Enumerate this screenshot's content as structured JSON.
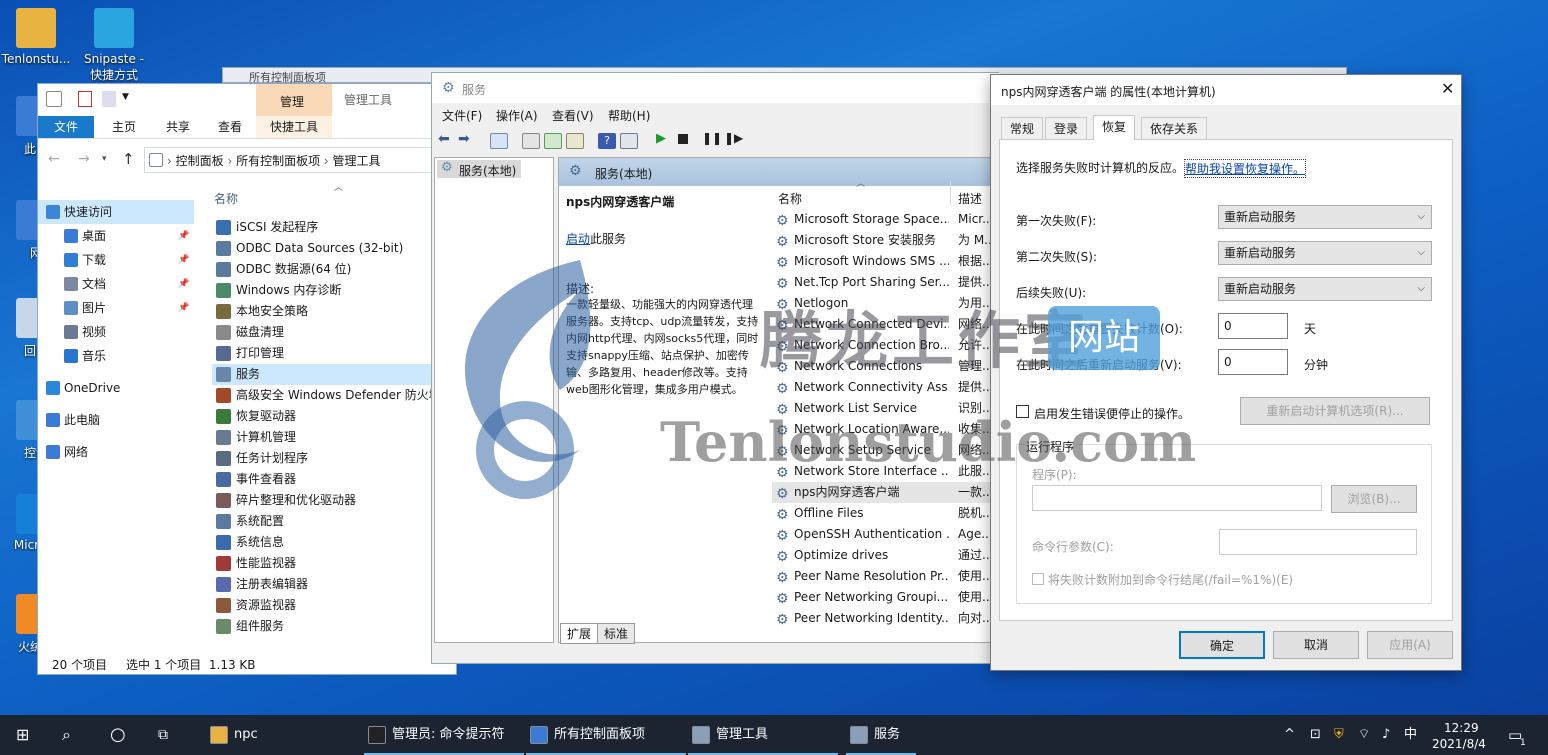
{
  "desktop": {
    "icons": [
      {
        "label": "Tenlonstu...",
        "color": "#e8b341"
      },
      {
        "label": "Snipaste - 快捷方式",
        "color": "#2aa5e0"
      },
      {
        "label": "此电",
        "color": "#3a7bd5"
      },
      {
        "label": "网",
        "color": "#3a7bd5"
      },
      {
        "label": "回收",
        "color": "#c7d6e8"
      },
      {
        "label": "控制",
        "color": "#3e8fd8"
      },
      {
        "label": "Micr Ed",
        "color": "#1480d8"
      },
      {
        "label": "火绒安",
        "color": "#f08a24"
      }
    ]
  },
  "background_window": {
    "title": "所有控制面板项"
  },
  "explorer": {
    "ribbon_tabs": [
      "文件",
      "主页",
      "共享",
      "查看",
      "快捷工具"
    ],
    "manage_tab": "管理",
    "manage_title": "管理工具",
    "address": [
      "控制面板",
      "所有控制面板项",
      "管理工具"
    ],
    "column_name": "名称",
    "nav": [
      {
        "label": "快速访问",
        "color": "#3b86d9",
        "pin": false
      },
      {
        "label": "桌面",
        "color": "#3a7bd5",
        "pin": true
      },
      {
        "label": "下载",
        "color": "#2f7fd4",
        "pin": true
      },
      {
        "label": "文档",
        "color": "#7c8aa0",
        "pin": true
      },
      {
        "label": "图片",
        "color": "#5b8fc6",
        "pin": true
      },
      {
        "label": "视频",
        "color": "#6a7a90",
        "pin": false
      },
      {
        "label": "音乐",
        "color": "#2a76cf",
        "pin": false
      },
      {
        "label": "OneDrive",
        "color": "#2b88d8",
        "pin": false
      },
      {
        "label": "此电脑",
        "color": "#3a7bd5",
        "pin": false
      },
      {
        "label": "网络",
        "color": "#3a7bd5",
        "pin": false
      }
    ],
    "files": [
      "iSCSI 发起程序",
      "ODBC Data Sources (32-bit)",
      "ODBC 数据源(64 位)",
      "Windows 内存诊断",
      "本地安全策略",
      "磁盘清理",
      "打印管理",
      "服务",
      "高级安全 Windows Defender 防火墙",
      "恢复驱动器",
      "计算机管理",
      "任务计划程序",
      "事件查看器",
      "碎片整理和优化驱动器",
      "系统配置",
      "系统信息",
      "性能监视器",
      "注册表编辑器",
      "资源监视器",
      "组件服务"
    ],
    "status_count": "20 个项目",
    "status_selected": "选中 1 个项目  1.13 KB"
  },
  "services": {
    "title": "服务",
    "menu": [
      "文件(F)",
      "操作(A)",
      "查看(V)",
      "帮助(H)"
    ],
    "tree_item": "服务(本地)",
    "header": "服务(本地)",
    "selected_name": "nps内网穿透客户端",
    "start_link": "启动",
    "start_suffix": "此服务",
    "desc_label": "描述:",
    "desc": "一款轻量级、功能强大的内网穿透代理服务器。支持tcp、udp流量转发，支持内网http代理、内网socks5代理，同时支持snappy压缩、站点保护、加密传输、多路复用、header修改等。支持web图形化管理，集成多用户模式。",
    "col_name": "名称",
    "col_desc": "描述",
    "rows": [
      {
        "name": "Microsoft Storage Space...",
        "desc": "Micr..."
      },
      {
        "name": "Microsoft Store 安装服务",
        "desc": "为 M..."
      },
      {
        "name": "Microsoft Windows SMS ...",
        "desc": "根据..."
      },
      {
        "name": "Net.Tcp Port Sharing Ser...",
        "desc": "提供..."
      },
      {
        "name": "Netlogon",
        "desc": "为用..."
      },
      {
        "name": "Network Connected Devi...",
        "desc": "网络..."
      },
      {
        "name": "Network Connection Bro...",
        "desc": "允许..."
      },
      {
        "name": "Network Connections",
        "desc": "管理..."
      },
      {
        "name": "Network Connectivity Ass...",
        "desc": "提供..."
      },
      {
        "name": "Network List Service",
        "desc": "识别..."
      },
      {
        "name": "Network Location Aware...",
        "desc": "收集..."
      },
      {
        "name": "Network Setup Service",
        "desc": "网络..."
      },
      {
        "name": "Network Store Interface ...",
        "desc": "此服..."
      },
      {
        "name": "nps内网穿透客户端",
        "desc": "一款..."
      },
      {
        "name": "Offline Files",
        "desc": "脱机..."
      },
      {
        "name": "OpenSSH Authentication ...",
        "desc": "Age..."
      },
      {
        "name": "Optimize drives",
        "desc": "通过..."
      },
      {
        "name": "Peer Name Resolution Pr...",
        "desc": "使用..."
      },
      {
        "name": "Peer Networking Groupi...",
        "desc": "使用..."
      },
      {
        "name": "Peer Networking Identity...",
        "desc": "向对..."
      }
    ],
    "bottom_tabs": [
      "扩展",
      "标准"
    ]
  },
  "props": {
    "title": "nps内网穿透客户端 的属性(本地计算机)",
    "tabs": [
      "常规",
      "登录",
      "恢复",
      "依存关系"
    ],
    "intro": "选择服务失败时计算机的反应。",
    "help_link": "帮助我设置恢复操作。",
    "first_label": "第一次失败(F):",
    "first_value": "重新启动服务",
    "second_label": "第二次失败(S):",
    "second_value": "重新启动服务",
    "subsequent_label": "后续失败(U):",
    "subsequent_value": "重新启动服务",
    "reset_label": "在此时间之后重置失败计数(O):",
    "reset_value": "0",
    "reset_unit": "天",
    "restart_label": "在此时间之后重新启动服务(V):",
    "restart_value": "0",
    "restart_unit": "分钟",
    "enable_actions": "启用发生错误便停止的操作。",
    "restart_computer_btn": "重新启动计算机选项(R)...",
    "run_program_group": "运行程序",
    "program_label": "程序(P):",
    "browse_btn": "浏览(B)...",
    "cmd_label": "命令行参数(C):",
    "append_fail": "将失败计数附加到命令行结尾(/fail=%1%)(E)",
    "ok": "确定",
    "cancel": "取消",
    "apply": "应用(A)"
  },
  "watermark": {
    "cn": "腾龙工作室",
    "badge": "网站",
    "url": "Tenlonstudio.com"
  },
  "taskbar": {
    "items": [
      {
        "label": "npc",
        "color": "#e8b341"
      },
      {
        "label": "管理员: 命令提示符",
        "color": "#222"
      },
      {
        "label": "所有控制面板项",
        "color": "#3a7bd5"
      },
      {
        "label": "管理工具",
        "color": "#8aa0b8"
      },
      {
        "label": "服务",
        "color": "#8aa0b8"
      }
    ],
    "ime": "中",
    "time": "12:29",
    "date": "2021/8/4",
    "notif_count": "1"
  }
}
